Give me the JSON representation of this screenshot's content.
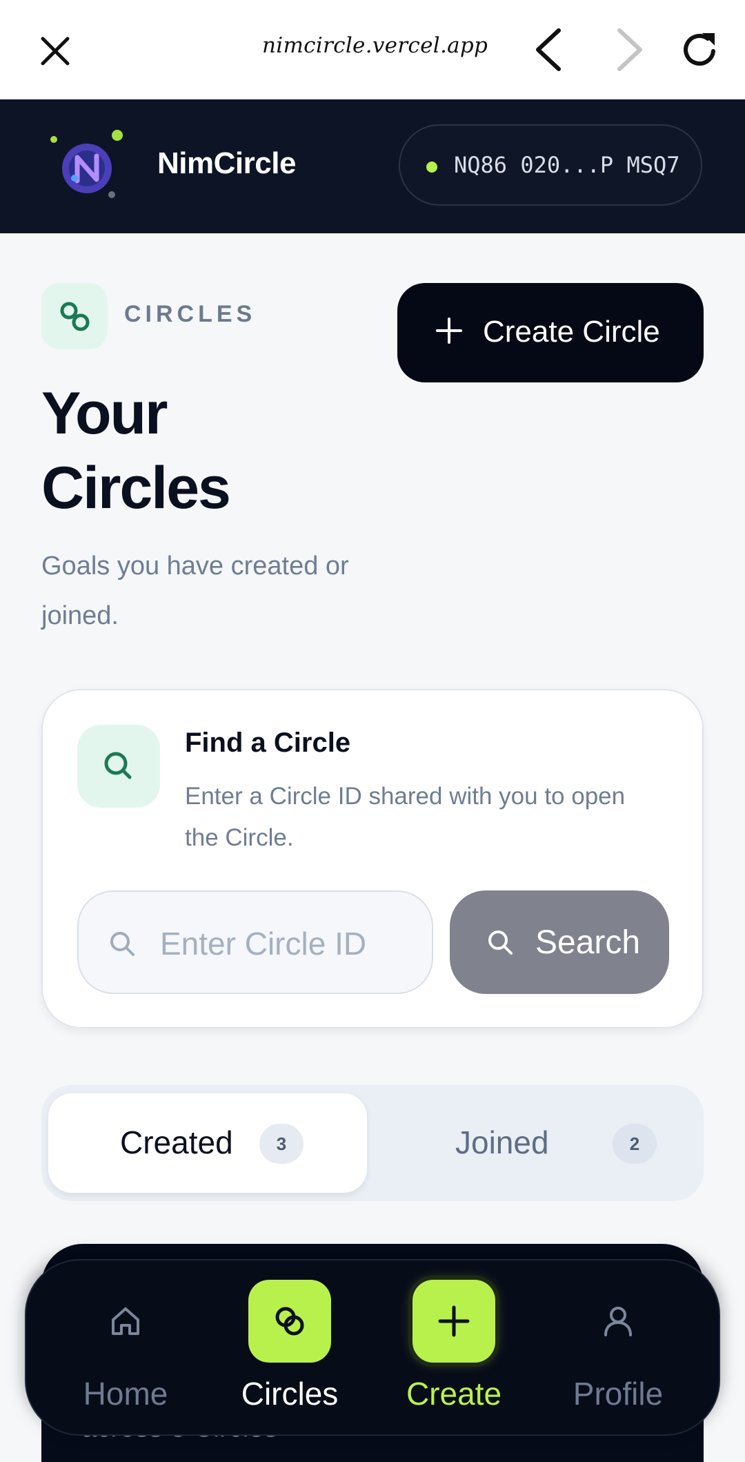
{
  "browser": {
    "url": "nimcircle.vercel.app"
  },
  "header": {
    "brand": "NimCircle",
    "wallet_address": "NQ86 020...P MSQ7",
    "wallet_status_color": "#b6f24a"
  },
  "page": {
    "section_label": "CIRCLES",
    "title": "Your Circles",
    "subtitle": "Goals you have created or joined.",
    "create_button_label": "Create Circle"
  },
  "find_circle": {
    "title": "Find a Circle",
    "description": "Enter a Circle ID shared with you to open the Circle.",
    "input_placeholder": "Enter Circle ID",
    "input_value": "",
    "search_button_label": "Search"
  },
  "tabs": [
    {
      "label": "Created",
      "count": "3",
      "active": true
    },
    {
      "label": "Joined",
      "count": "2",
      "active": false
    }
  ],
  "card_peek_text": "across 3 Circles",
  "bottom_nav": [
    {
      "label": "Home",
      "icon": "home-icon"
    },
    {
      "label": "Circles",
      "icon": "circles-icon",
      "active": true
    },
    {
      "label": "Create",
      "icon": "plus-icon"
    },
    {
      "label": "Profile",
      "icon": "user-icon"
    }
  ],
  "colors": {
    "accent": "#b9f14c",
    "header_bg": "#0d1425",
    "primary_button": "#050915"
  }
}
